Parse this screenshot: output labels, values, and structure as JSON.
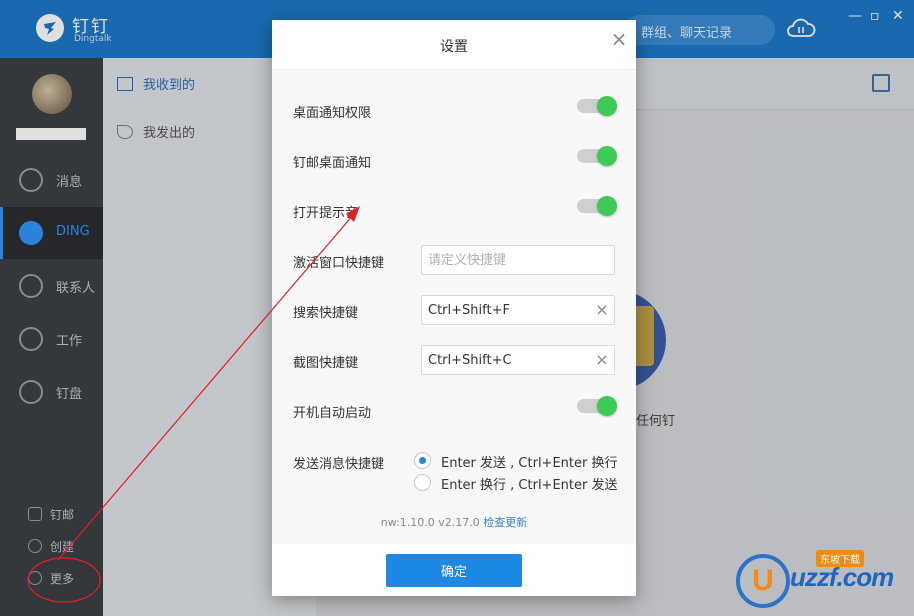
{
  "app": {
    "name": "钉钉",
    "sub": "Dingtalk",
    "search_hint": "群组、聊天记录"
  },
  "nav": {
    "items": [
      {
        "label": "消息",
        "icon": "smile-icon"
      },
      {
        "label": "DING",
        "icon": "ding-icon",
        "active": true
      },
      {
        "label": "联系人",
        "icon": "contact-icon"
      },
      {
        "label": "工作",
        "icon": "compass-icon"
      },
      {
        "label": "钉盘",
        "icon": "cloud-disk-icon"
      }
    ],
    "bottom": [
      {
        "label": "钉邮",
        "icon": "mail-icon"
      },
      {
        "label": "创建",
        "icon": "plus-circle-icon"
      },
      {
        "label": "更多",
        "icon": "more-icon"
      }
    ]
  },
  "subnav": {
    "received": "我收到的",
    "sent": "我发出的"
  },
  "content": {
    "empty_text": "任何钉"
  },
  "dialog": {
    "title": "设置",
    "rows": [
      {
        "label": "桌面通知权限",
        "type": "toggle",
        "on": true
      },
      {
        "label": "钉邮桌面通知",
        "type": "toggle",
        "on": true
      },
      {
        "label": "打开提示音",
        "type": "toggle",
        "on": true
      },
      {
        "label": "激活窗口快捷键",
        "type": "input",
        "value": "",
        "placeholder": "请定义快捷键"
      },
      {
        "label": "搜索快捷键",
        "type": "input",
        "value": "Ctrl+Shift+F",
        "placeholder": ""
      },
      {
        "label": "截图快捷键",
        "type": "input",
        "value": "Ctrl+Shift+C",
        "placeholder": ""
      },
      {
        "label": "开机自动启动",
        "type": "toggle",
        "on": true
      }
    ],
    "send_shortcut": {
      "label": "发送消息快捷键",
      "options": [
        {
          "label": "Enter 发送 , Ctrl+Enter 换行",
          "checked": true
        },
        {
          "label": "Enter 换行 , Ctrl+Enter 发送",
          "checked": false
        }
      ]
    },
    "version": "nw:1.10.0 v2.17.0",
    "check_update": "检查更新",
    "ok_label": "确定"
  },
  "colors": {
    "accent": "#1e88e5",
    "toggle_on": "#3ecb55",
    "annotation": "#e02020",
    "titlebar": "#1e78c8"
  },
  "watermark": {
    "text": "uzzf.com",
    "tag": "东坡下载"
  }
}
